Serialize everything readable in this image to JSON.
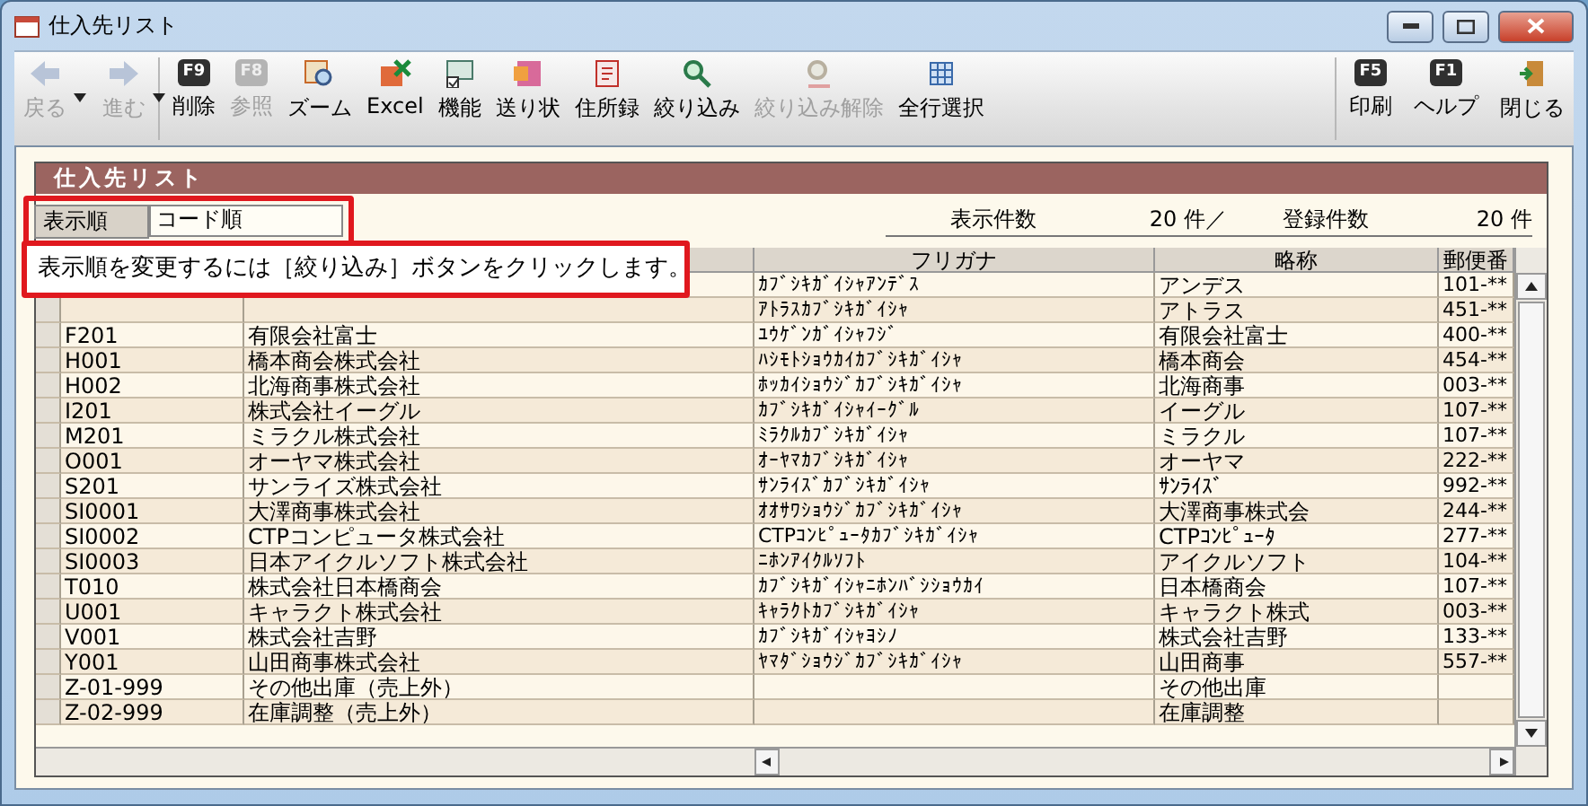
{
  "window": {
    "title": "仕入先リスト"
  },
  "toolbar": {
    "left": [
      {
        "label": "戻る",
        "kind": "icon",
        "disabled": true,
        "dropdown": true
      },
      {
        "label": "進む",
        "kind": "icon",
        "disabled": true,
        "dropdown": true
      },
      {
        "label": "削除",
        "kind": "key",
        "key": "F9",
        "disabled": false
      },
      {
        "label": "参照",
        "kind": "key",
        "key": "F8",
        "disabled": true
      },
      {
        "label": "ズーム",
        "kind": "icon",
        "disabled": false
      },
      {
        "label": "Excel",
        "kind": "icon",
        "disabled": false
      },
      {
        "label": "機能",
        "kind": "icon",
        "disabled": false
      },
      {
        "label": "送り状",
        "kind": "icon",
        "disabled": false
      },
      {
        "label": "住所録",
        "kind": "icon",
        "disabled": false
      },
      {
        "label": "絞り込み",
        "kind": "icon",
        "disabled": false
      },
      {
        "label": "絞り込み解除",
        "kind": "icon",
        "disabled": true
      },
      {
        "label": "全行選択",
        "kind": "icon",
        "disabled": false
      }
    ],
    "right": [
      {
        "label": "印刷",
        "kind": "key",
        "key": "F5",
        "disabled": false
      },
      {
        "label": "ヘルプ",
        "kind": "key",
        "key": "F1",
        "disabled": false
      },
      {
        "label": "閉じる",
        "kind": "icon",
        "disabled": false
      }
    ]
  },
  "section_title": "仕入先リスト",
  "sort": {
    "label": "表示順",
    "value": "コード順"
  },
  "counts": {
    "shown_label": "表示件数",
    "shown_value": "20 件／",
    "registered_label": "登録件数",
    "registered_value": "20 件"
  },
  "callout": "表示順を変更するには［絞り込み］ボタンをクリックします。",
  "table": {
    "columns": [
      "フリガナ",
      "略称",
      "郵便番"
    ],
    "rows": [
      {
        "furigana": "ｶﾌﾞｼｷｶﾞｲｼｬｱﾝﾃﾞｽ",
        "short": "アンデス",
        "postal": "101-**"
      },
      {
        "furigana": "ｱﾄﾗｽｶﾌﾞｼｷｶﾞｲｼｬ",
        "short": "アトラス",
        "postal": "451-**"
      },
      {
        "code": "F201",
        "name": "有限会社富士",
        "furigana": "ﾕｳｹﾞﾝｶﾞｲｼｬﾌｼﾞ",
        "short": "有限会社富士",
        "postal": "400-**"
      },
      {
        "code": "H001",
        "name": "橋本商会株式会社",
        "furigana": "ﾊｼﾓﾄｼｮｳｶｲｶﾌﾞｼｷｶﾞｲｼｬ",
        "short": "橋本商会",
        "postal": "454-**"
      },
      {
        "code": "H002",
        "name": "北海商事株式会社",
        "furigana": "ﾎｯｶｲｼｮｳｼﾞｶﾌﾞｼｷｶﾞｲｼｬ",
        "short": "北海商事",
        "postal": "003-**"
      },
      {
        "code": "I201",
        "name": "株式会社イーグル",
        "furigana": "ｶﾌﾞｼｷｶﾞｲｼｬｲｰｸﾞﾙ",
        "short": "イーグル",
        "postal": "107-**"
      },
      {
        "code": "M201",
        "name": "ミラクル株式会社",
        "furigana": "ﾐﾗｸﾙｶﾌﾞｼｷｶﾞｲｼｬ",
        "short": "ミラクル",
        "postal": "107-**"
      },
      {
        "code": "O001",
        "name": "オーヤマ株式会社",
        "furigana": "ｵｰﾔﾏｶﾌﾞｼｷｶﾞｲｼｬ",
        "short": "オーヤマ",
        "postal": "222-**"
      },
      {
        "code": "S201",
        "name": "サンライズ株式会社",
        "furigana": "ｻﾝﾗｲｽﾞｶﾌﾞｼｷｶﾞｲｼｬ",
        "short": "ｻﾝﾗｲｽﾞ",
        "postal": "992-**"
      },
      {
        "code": "SI0001",
        "name": "大澤商事株式会社",
        "furigana": "ｵｵｻﾜｼｮｳｼﾞｶﾌﾞｼｷｶﾞｲｼｬ",
        "short": "大澤商事株式会",
        "postal": "244-**"
      },
      {
        "code": "SI0002",
        "name": "CTPコンピュータ株式会社",
        "furigana": "CTPｺﾝﾋﾟｭｰﾀｶﾌﾞｼｷｶﾞｲｼｬ",
        "short": "CTPｺﾝﾋﾟｭｰﾀ",
        "postal": "277-**"
      },
      {
        "code": "SI0003",
        "name": "日本アイクルソフト株式会社",
        "furigana": "ﾆﾎﾝｱｲｸﾙｿﾌﾄ",
        "short": "アイクルソフト",
        "postal": "104-**"
      },
      {
        "code": "T010",
        "name": "株式会社日本橋商会",
        "furigana": "ｶﾌﾞｼｷｶﾞｲｼｬﾆﾎﾝﾊﾞｼｼｮｳｶｲ",
        "short": "日本橋商会",
        "postal": "107-**"
      },
      {
        "code": "U001",
        "name": "キャラクト株式会社",
        "furigana": "ｷｬﾗｸﾄｶﾌﾞｼｷｶﾞｲｼｬ",
        "short": "キャラクト株式",
        "postal": "003-**"
      },
      {
        "code": "V001",
        "name": "株式会社吉野",
        "furigana": "ｶﾌﾞｼｷｶﾞｲｼｬﾖｼﾉ",
        "short": "株式会社吉野",
        "postal": "133-**"
      },
      {
        "code": "Y001",
        "name": "山田商事株式会社",
        "furigana": "ﾔﾏﾀﾞｼｮｳｼﾞｶﾌﾞｼｷｶﾞｲｼｬ",
        "short": "山田商事",
        "postal": "557-**"
      },
      {
        "code": "Z-01-999",
        "name": "その他出庫（売上外）",
        "short": "その他出庫"
      },
      {
        "code": "Z-02-999",
        "name": "在庫調整（売上外）",
        "short": "在庫調整"
      }
    ]
  }
}
